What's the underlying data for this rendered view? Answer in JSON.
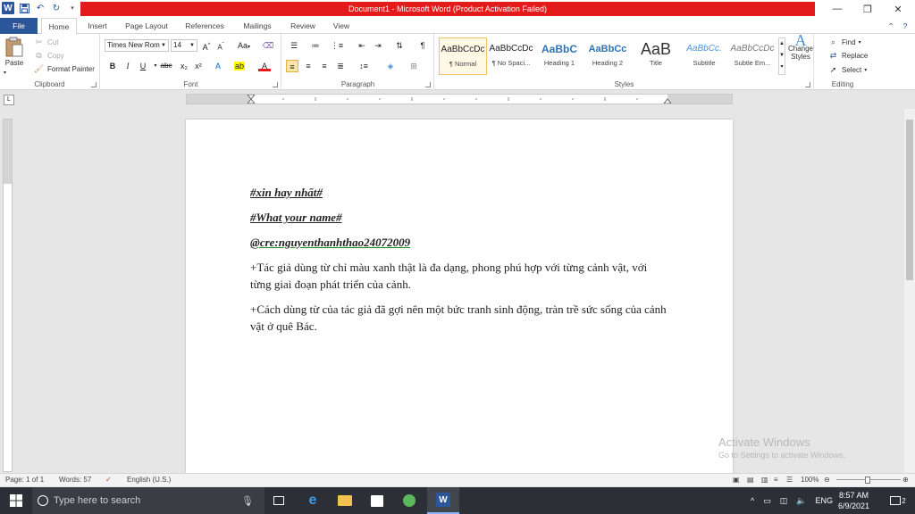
{
  "window": {
    "title": "Document1  -  Microsoft Word (Product Activation Failed)",
    "colors": {
      "word_blue": "#2b579a",
      "activation_bar": "#e31b1b"
    }
  },
  "quick_access": {
    "icons": [
      "word-logo-icon",
      "save-icon",
      "undo-icon",
      "redo-icon",
      "customize-qat-icon"
    ]
  },
  "tabs": [
    "File",
    "Home",
    "Insert",
    "Page Layout",
    "References",
    "Mailings",
    "Review",
    "View"
  ],
  "active_tab": "Home",
  "clipboard": {
    "paste": "Paste",
    "cut": "Cut",
    "copy": "Copy",
    "format_painter": "Format Painter",
    "label": "Clipboard"
  },
  "font": {
    "name": "Times New Rom",
    "size": "14",
    "label": "Font",
    "grow": "A",
    "shrink": "A",
    "case": "Aa",
    "bold": "B",
    "italic": "I",
    "underline": "U",
    "strike": "abc",
    "sub": "x₂",
    "sup": "x²"
  },
  "paragraph": {
    "label": "Paragraph",
    "pilcrow": "¶"
  },
  "styles": {
    "label": "Styles",
    "items": [
      {
        "preview": "AaBbCcDc",
        "name": "¶ Normal"
      },
      {
        "preview": "AaBbCcDc",
        "name": "¶ No Spaci..."
      },
      {
        "preview": "AaBbC",
        "name": "Heading 1"
      },
      {
        "preview": "AaBbCc",
        "name": "Heading 2"
      },
      {
        "preview": "AaB",
        "name": "Title"
      },
      {
        "preview": "AaBbCc.",
        "name": "Subtitle"
      },
      {
        "preview": "AaBbCcDc",
        "name": "Subtle Em..."
      }
    ],
    "change_styles": "Change Styles"
  },
  "editing": {
    "find": "Find",
    "replace": "Replace",
    "select": "Select",
    "label": "Editing"
  },
  "document": {
    "line1": "#xin hay nhất#",
    "line2": "#What your name#",
    "line3": "@cre:nguyenthanhthao24072009",
    "para1": "+Tác giả dùng từ chỉ màu xanh thật là đa dạng, phong phú hợp với từng cảnh vật, với từng giai đoạn phát triển của cảnh.",
    "para2": "+Cách dùng từ của tác giả đã gợi nên một bức tranh sinh động, tràn trề sức sống của cảnh vật ở quê Bác."
  },
  "watermark": {
    "line1": "Activate Windows",
    "line2": "Go to Settings to activate Windows."
  },
  "status": {
    "page": "Page: 1 of 1",
    "words": "Words: 57",
    "language": "English (U.S.)",
    "zoom": "100%"
  },
  "taskbar": {
    "search_placeholder": "Type here to search",
    "lang": "ENG",
    "time": "8:57 AM",
    "date": "6/9/2021",
    "notifications": "2"
  }
}
